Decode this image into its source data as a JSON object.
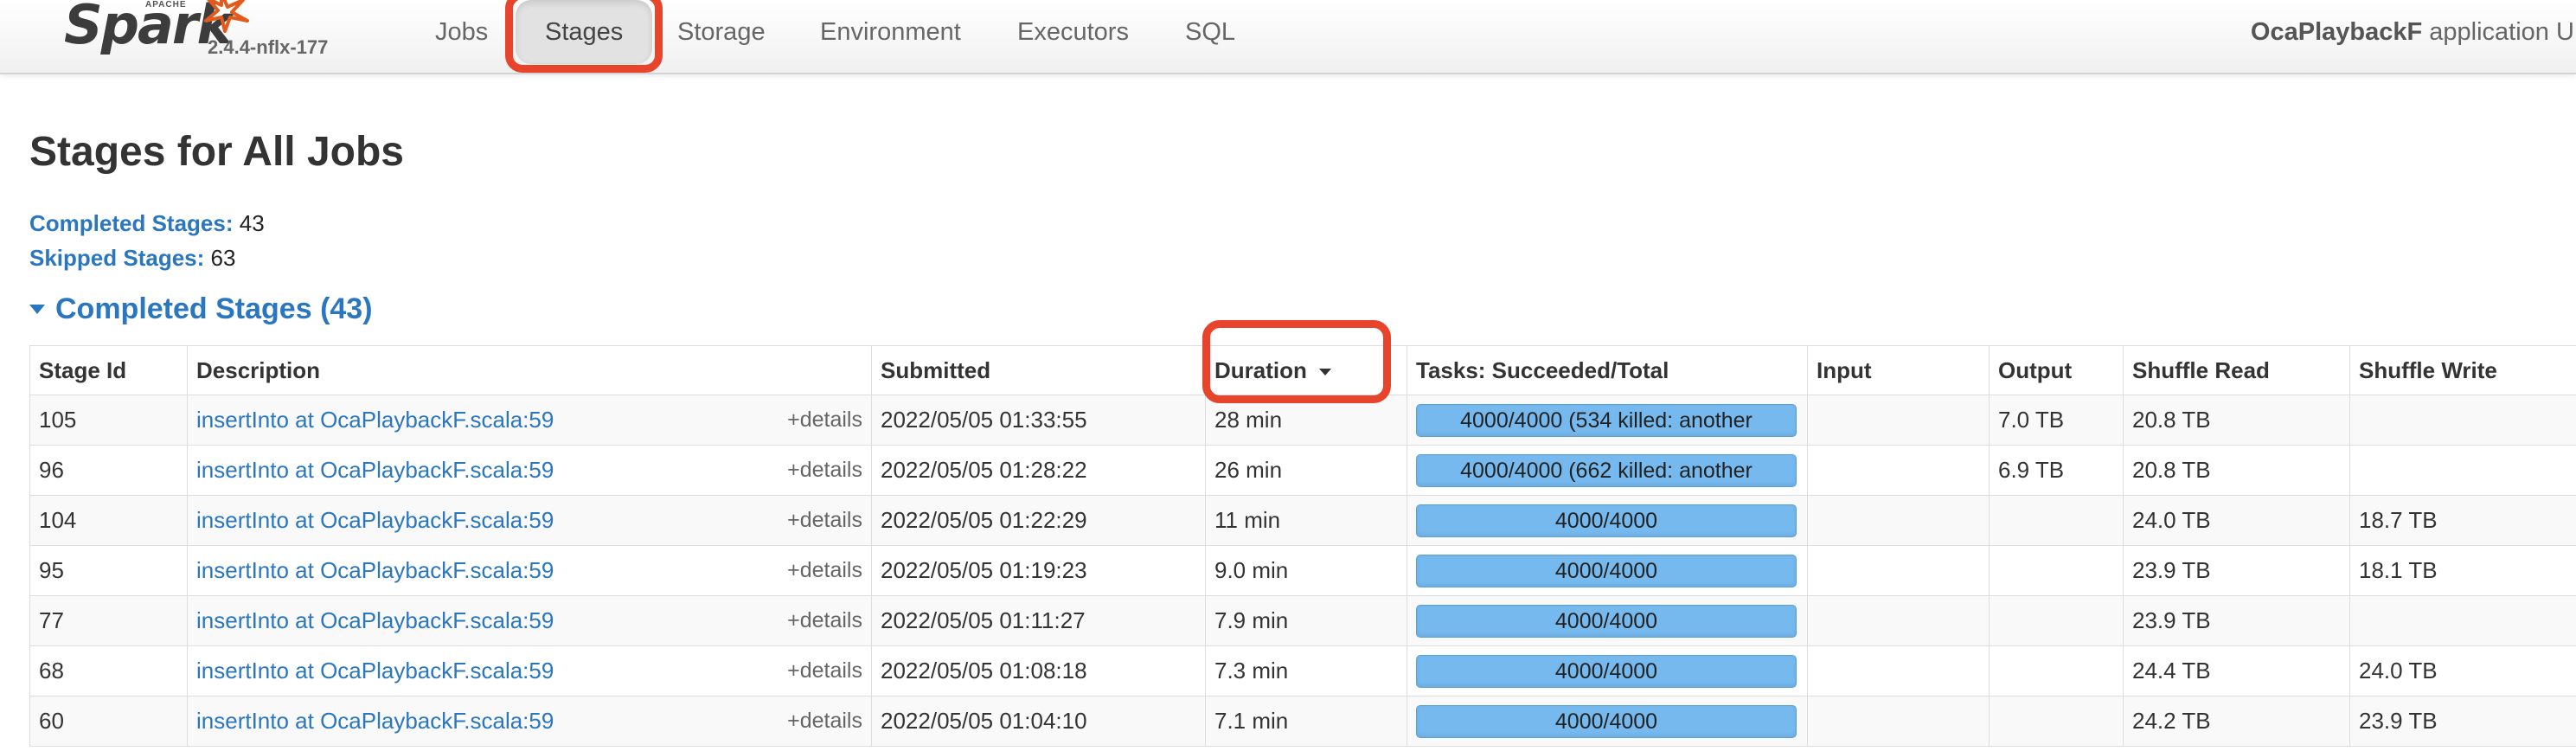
{
  "nav": {
    "brand_apache": "APACHE",
    "brand_name": "Spark",
    "version": "2.4.4-nflx-177",
    "tabs": [
      "Jobs",
      "Stages",
      "Storage",
      "Environment",
      "Executors",
      "SQL"
    ],
    "active_tab": "Stages",
    "app_name": "OcaPlaybackF",
    "app_suffix": " application UI"
  },
  "page": {
    "title": "Stages for All Jobs",
    "completed_label": "Completed Stages:",
    "completed_value": "43",
    "skipped_label": "Skipped Stages:",
    "skipped_value": "63",
    "section_title": "Completed Stages (43)"
  },
  "table": {
    "headers": [
      "Stage Id",
      "Description",
      "Submitted",
      "Duration",
      "Tasks: Succeeded/Total",
      "Input",
      "Output",
      "Shuffle Read",
      "Shuffle Write"
    ],
    "sorted_by": "Duration",
    "details_label": "+details",
    "rows": [
      {
        "id": "105",
        "desc": "insertInto at OcaPlaybackF.scala:59",
        "submitted": "2022/05/05 01:33:55",
        "duration": "28 min",
        "tasks": "4000/4000 (534 killed: another",
        "input": "",
        "output": "7.0 TB",
        "shuffle_read": "20.8 TB",
        "shuffle_write": ""
      },
      {
        "id": "96",
        "desc": "insertInto at OcaPlaybackF.scala:59",
        "submitted": "2022/05/05 01:28:22",
        "duration": "26 min",
        "tasks": "4000/4000 (662 killed: another",
        "input": "",
        "output": "6.9 TB",
        "shuffle_read": "20.8 TB",
        "shuffle_write": ""
      },
      {
        "id": "104",
        "desc": "insertInto at OcaPlaybackF.scala:59",
        "submitted": "2022/05/05 01:22:29",
        "duration": "11 min",
        "tasks": "4000/4000",
        "input": "",
        "output": "",
        "shuffle_read": "24.0 TB",
        "shuffle_write": "18.7 TB"
      },
      {
        "id": "95",
        "desc": "insertInto at OcaPlaybackF.scala:59",
        "submitted": "2022/05/05 01:19:23",
        "duration": "9.0 min",
        "tasks": "4000/4000",
        "input": "",
        "output": "",
        "shuffle_read": "23.9 TB",
        "shuffle_write": "18.1 TB"
      },
      {
        "id": "77",
        "desc": "insertInto at OcaPlaybackF.scala:59",
        "submitted": "2022/05/05 01:11:27",
        "duration": "7.9 min",
        "tasks": "4000/4000",
        "input": "",
        "output": "",
        "shuffle_read": "23.9 TB",
        "shuffle_write": ""
      },
      {
        "id": "68",
        "desc": "insertInto at OcaPlaybackF.scala:59",
        "submitted": "2022/05/05 01:08:18",
        "duration": "7.3 min",
        "tasks": "4000/4000",
        "input": "",
        "output": "",
        "shuffle_read": "24.4 TB",
        "shuffle_write": "24.0 TB"
      },
      {
        "id": "60",
        "desc": "insertInto at OcaPlaybackF.scala:59",
        "submitted": "2022/05/05 01:04:10",
        "duration": "7.1 min",
        "tasks": "4000/4000",
        "input": "",
        "output": "",
        "shuffle_read": "24.2 TB",
        "shuffle_write": "23.9 TB"
      }
    ]
  },
  "colors": {
    "link": "#2a76bf",
    "progress": "#75b9ef",
    "annotation": "#e8432b"
  },
  "icons": [
    "spark-star-logo",
    "caret-down-icon",
    "sort-desc-icon"
  ]
}
